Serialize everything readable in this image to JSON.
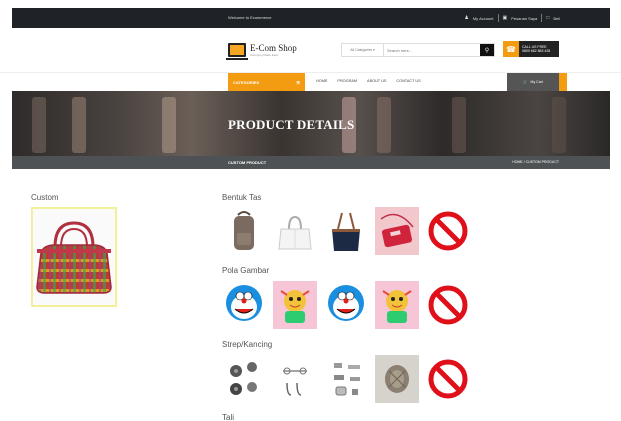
{
  "topbar": {
    "welcome": "Welcome to Ecommerce",
    "my_account": "My Account",
    "cart_label": "Pesanan Saya",
    "user": "Beli"
  },
  "header": {
    "logo_title": "E-Com Shop",
    "logo_tagline": "Shopping Made Easy",
    "search_category": "All Categories",
    "search_placeholder": "Search here...",
    "phone_line1": "CALL US FREE",
    "phone_line2": "0800 662 863 428"
  },
  "nav": {
    "categories_label": "CATEGORIES",
    "items": [
      "HOME",
      "PROGRAM",
      "ABOUT US",
      "CONTACT US"
    ],
    "cart_label": "My Cart"
  },
  "banner": {
    "title": "PRODUCT DETAILS",
    "crumb_title": "CUSTOM PRODUCT",
    "breadcrumb": "HOME / CUSTOM PRODUCT"
  },
  "main": {
    "custom_label": "Custom",
    "sections": [
      {
        "title": "Bentuk Tas",
        "options": [
          "brown-backpack-icon",
          "white-handbag-icon",
          "navy-tote-icon",
          "red-sling-bag-icon",
          "none-option-icon"
        ]
      },
      {
        "title": "Pola Gambar",
        "options": [
          "doraemon-pattern-icon",
          "character-pattern-icon",
          "doraemon-pattern-icon",
          "character-pattern-icon",
          "none-option-icon"
        ]
      },
      {
        "title": "Strep/Kancing",
        "options": [
          "button-set-icon",
          "clasp-set-icon",
          "hook-set-icon",
          "metal-closure-icon",
          "none-option-icon"
        ]
      },
      {
        "title": "Tali",
        "options": []
      }
    ]
  },
  "colors": {
    "accent": "#f39c12",
    "topbar": "#1f2327",
    "crumbbar": "#4f5254",
    "none_red": "#e0101a"
  }
}
